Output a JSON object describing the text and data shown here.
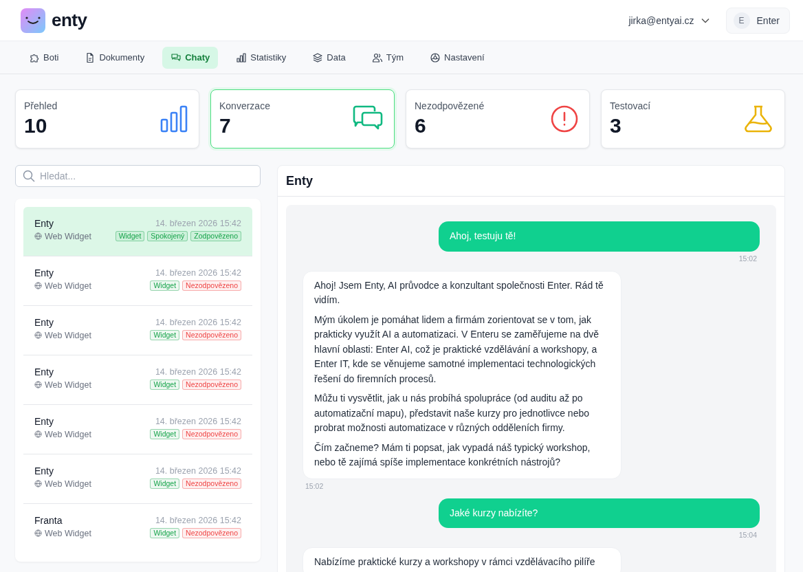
{
  "header": {
    "logo_text": "enty",
    "account": "jirka@entyai.cz",
    "org": {
      "initial": "E",
      "name": "Enter"
    }
  },
  "nav": [
    {
      "label": "Boti",
      "kind": "puzzle",
      "selected": false
    },
    {
      "label": "Dokumenty",
      "kind": "document",
      "selected": false
    },
    {
      "label": "Chaty",
      "kind": "chat",
      "selected": true
    },
    {
      "label": "Statistiky",
      "kind": "bars",
      "selected": false
    },
    {
      "label": "Data",
      "kind": "layers",
      "selected": false
    },
    {
      "label": "Tým",
      "kind": "users",
      "selected": false
    },
    {
      "label": "Nastavení",
      "kind": "gear",
      "selected": false
    }
  ],
  "stats": [
    {
      "label": "Přehled",
      "value": "10",
      "kind": "bars",
      "color": "#3b82f6",
      "selected": false
    },
    {
      "label": "Konverzace",
      "value": "7",
      "kind": "chat",
      "color": "#10b981",
      "selected": true
    },
    {
      "label": "Nezodpovězené",
      "value": "6",
      "kind": "alert",
      "color": "#ef4444",
      "selected": false
    },
    {
      "label": "Testovací",
      "value": "3",
      "kind": "flask",
      "color": "#eab308",
      "selected": false
    }
  ],
  "search": {
    "placeholder": "Hledat..."
  },
  "chats": [
    {
      "name": "Enty",
      "date": "14. březen 2026 15:42",
      "source": "Web Widget",
      "selected": true,
      "tags": [
        {
          "label": "Widget",
          "color": "#16a34a"
        },
        {
          "label": "Spokojený",
          "color": "#16a34a"
        },
        {
          "label": "Zodpovězeno",
          "color": "#16a34a"
        }
      ]
    },
    {
      "name": "Enty",
      "date": "14. březen 2026 15:42",
      "source": "Web Widget",
      "selected": false,
      "tags": [
        {
          "label": "Widget",
          "color": "#16a34a"
        },
        {
          "label": "Nezodpovězeno",
          "color": "#ef4444"
        }
      ]
    },
    {
      "name": "Enty",
      "date": "14. březen 2026 15:42",
      "source": "Web Widget",
      "selected": false,
      "tags": [
        {
          "label": "Widget",
          "color": "#16a34a"
        },
        {
          "label": "Nezodpovězeno",
          "color": "#ef4444"
        }
      ]
    },
    {
      "name": "Enty",
      "date": "14. březen 2026 15:42",
      "source": "Web Widget",
      "selected": false,
      "tags": [
        {
          "label": "Widget",
          "color": "#16a34a"
        },
        {
          "label": "Nezodpovězeno",
          "color": "#ef4444"
        }
      ]
    },
    {
      "name": "Enty",
      "date": "14. březen 2026 15:42",
      "source": "Web Widget",
      "selected": false,
      "tags": [
        {
          "label": "Widget",
          "color": "#16a34a"
        },
        {
          "label": "Nezodpovězeno",
          "color": "#ef4444"
        }
      ]
    },
    {
      "name": "Enty",
      "date": "14. březen 2026 15:42",
      "source": "Web Widget",
      "selected": false,
      "tags": [
        {
          "label": "Widget",
          "color": "#16a34a"
        },
        {
          "label": "Nezodpovězeno",
          "color": "#ef4444"
        }
      ]
    },
    {
      "name": "Franta",
      "date": "14. březen 2026 15:42",
      "source": "Web Widget",
      "selected": false,
      "tags": [
        {
          "label": "Widget",
          "color": "#16a34a"
        },
        {
          "label": "Nezodpovězeno",
          "color": "#ef4444"
        }
      ]
    }
  ],
  "conversation": {
    "title": "Enty",
    "messages": [
      {
        "kind": "user",
        "paragraphs": [
          "Ahoj, testuju tě!"
        ],
        "time": "15:02"
      },
      {
        "kind": "bot",
        "paragraphs": [
          "Ahoj! Jsem Enty, AI průvodce a konzultant společnosti Enter. Rád tě vidím.",
          "Mým úkolem je pomáhat lidem a firmám zorientovat se v tom, jak prakticky využít AI a automatizaci. V Enteru se zaměřujeme na dvě hlavní oblasti: Enter AI, což je praktické vzdělávání a workshopy, a Enter IT, kde se věnujeme samotné implementaci technologických řešení do firemních procesů.",
          "Můžu ti vysvětlit, jak u nás probíhá spolupráce (od auditu až po automatizační mapu), představit naše kurzy pro jednotlivce nebo probrat možnosti automatizace v různých odděleních firmy.",
          "Čím začneme? Mám ti popsat, jak vypadá náš typický workshop, nebo tě zajímá spíše implementace konkrétních nástrojů?"
        ],
        "time": "15:02"
      },
      {
        "kind": "user",
        "paragraphs": [
          "Jaké kurzy nabízíte?"
        ],
        "time": "15:04"
      },
      {
        "kind": "bot",
        "paragraphs": [
          "Nabízíme praktické kurzy a workshopy v rámci vzdělávacího pilíře"
        ]
      }
    ]
  }
}
